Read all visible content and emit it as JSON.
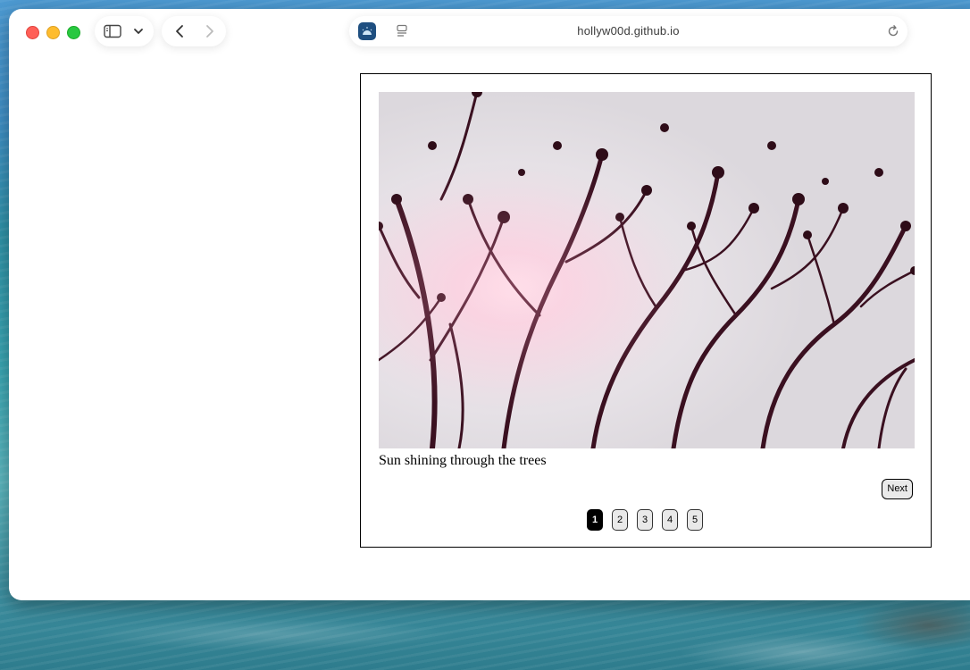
{
  "browser": {
    "url": "hollyw00d.github.io",
    "icons": {
      "sidebar": "sidebar-icon",
      "sidebar_menu": "chevron-down-icon",
      "back": "chevron-left-icon",
      "forward": "chevron-right-icon",
      "site": "site-favicon",
      "reader": "reader-icon",
      "reload": "reload-icon"
    }
  },
  "slideshow": {
    "caption": "Sun shining through the trees",
    "next_label": "Next",
    "pages": [
      "1",
      "2",
      "3",
      "4",
      "5"
    ],
    "active_page": "1"
  }
}
